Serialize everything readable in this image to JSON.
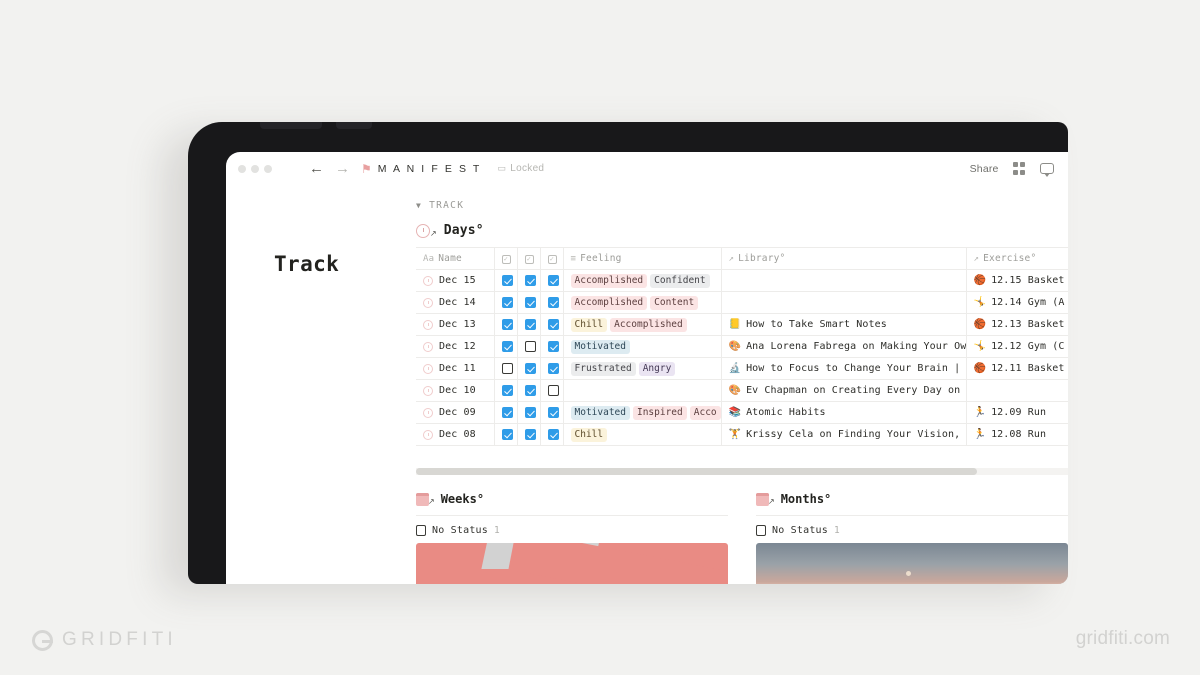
{
  "watermark": {
    "left_text": "GRIDFITI",
    "right_text": "gridfiti.com"
  },
  "topbar": {
    "breadcrumb": "M A N I F E S T",
    "locked_label": "Locked",
    "share_label": "Share",
    "back_glyph": "←",
    "forward_glyph": "→",
    "pin_glyph": "⚑",
    "lock_glyph": "▭"
  },
  "page": {
    "title": "Track",
    "section_label": "TRACK",
    "section_caret": "▼"
  },
  "days_db": {
    "title": "Days°",
    "columns": [
      {
        "label": "Name",
        "icon": "Aa"
      },
      {
        "label": "",
        "icon": "checkbox"
      },
      {
        "label": "",
        "icon": "checkbox"
      },
      {
        "label": "",
        "icon": "checkbox"
      },
      {
        "label": "Feeling",
        "icon": "≡"
      },
      {
        "label": "Library°",
        "icon": "↗"
      },
      {
        "label": "Exercise°",
        "icon": "↗"
      }
    ],
    "rows": [
      {
        "name": "Dec 15",
        "checks": [
          true,
          true,
          true
        ],
        "feelings": [
          {
            "text": "Accomplished",
            "color": "pink"
          },
          {
            "text": "Confident",
            "color": "gray"
          }
        ],
        "library": "",
        "library_icon": "",
        "exercise": "12.15 Basket",
        "exercise_icon": "🏀"
      },
      {
        "name": "Dec 14",
        "checks": [
          true,
          true,
          true
        ],
        "feelings": [
          {
            "text": "Accomplished",
            "color": "pink"
          },
          {
            "text": "Content",
            "color": "pink"
          }
        ],
        "library": "",
        "library_icon": "",
        "exercise": "12.14 Gym (A",
        "exercise_icon": "🤸"
      },
      {
        "name": "Dec 13",
        "checks": [
          true,
          true,
          true
        ],
        "feelings": [
          {
            "text": "Chill",
            "color": "yellow"
          },
          {
            "text": "Accomplished",
            "color": "pink"
          }
        ],
        "library": "How to Take Smart Notes",
        "library_icon": "📒",
        "exercise": "12.13 Basket",
        "exercise_icon": "🏀"
      },
      {
        "name": "Dec 12",
        "checks": [
          true,
          false,
          true
        ],
        "feelings": [
          {
            "text": "Motivated",
            "color": "blue"
          }
        ],
        "library": "Ana Lorena Fabrega on Making Your Ow",
        "library_icon": "🎨",
        "exercise": "12.12 Gym (C",
        "exercise_icon": "🤸"
      },
      {
        "name": "Dec 11",
        "checks": [
          false,
          true,
          true
        ],
        "feelings": [
          {
            "text": "Frustrated",
            "color": "gray"
          },
          {
            "text": "Angry",
            "color": "purple"
          }
        ],
        "library": "How to Focus to Change Your Brain | I",
        "library_icon": "🔬",
        "exercise": "12.11 Basket",
        "exercise_icon": "🏀"
      },
      {
        "name": "Dec 10",
        "checks": [
          true,
          true,
          false
        ],
        "feelings": [],
        "library": "Ev Chapman on Creating Every Day on",
        "library_icon": "🎨",
        "exercise": "",
        "exercise_icon": ""
      },
      {
        "name": "Dec 09",
        "checks": [
          true,
          true,
          true
        ],
        "feelings": [
          {
            "text": "Motivated",
            "color": "blue"
          },
          {
            "text": "Inspired",
            "color": "pink"
          },
          {
            "text": "Acco",
            "color": "pink"
          }
        ],
        "library": "Atomic Habits",
        "library_icon": "📚",
        "exercise": "12.09 Run",
        "exercise_icon": "🏃"
      },
      {
        "name": "Dec 08",
        "checks": [
          true,
          true,
          true
        ],
        "feelings": [
          {
            "text": "Chill",
            "color": "yellow"
          }
        ],
        "library": "Krissy Cela on Finding Your Vision, I",
        "library_icon": "🏋",
        "exercise": "12.08 Run",
        "exercise_icon": "🏃"
      }
    ]
  },
  "weeks_db": {
    "title": "Weeks°",
    "status_label": "No Status",
    "status_count": "1"
  },
  "months_db": {
    "title": "Months°",
    "status_label": "No Status",
    "status_count": "1"
  }
}
